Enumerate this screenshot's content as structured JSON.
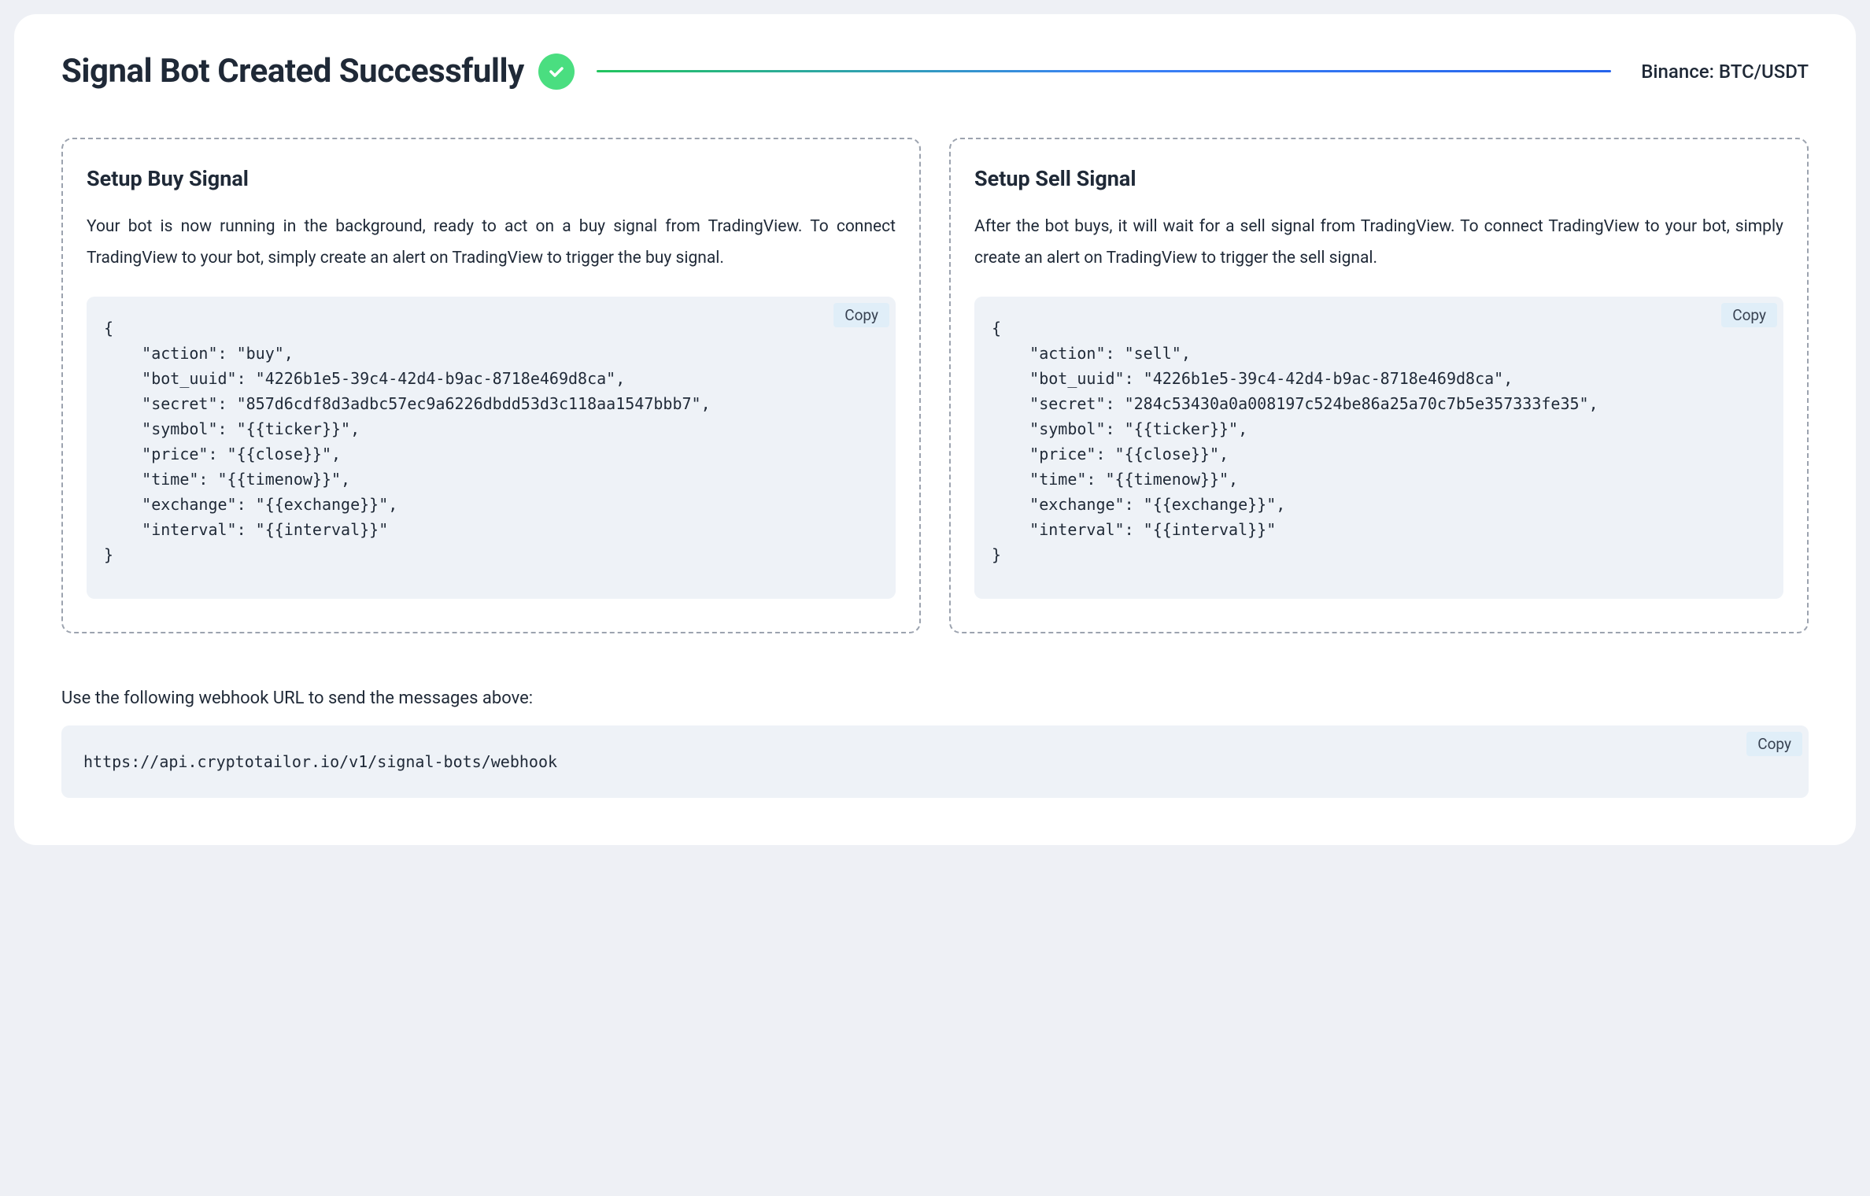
{
  "header": {
    "title": "Signal Bot Created Successfully",
    "exchange_pair": "Binance: BTC/USDT"
  },
  "buy_panel": {
    "title": "Setup Buy Signal",
    "description": "Your bot is now running in the background, ready to act on a buy signal from TradingView. To connect TradingView to your bot, simply create an alert on TradingView to trigger the buy signal.",
    "copy_label": "Copy",
    "payload": "{\n    \"action\": \"buy\",\n    \"bot_uuid\": \"4226b1e5-39c4-42d4-b9ac-8718e469d8ca\",\n    \"secret\": \"857d6cdf8d3adbc57ec9a6226dbdd53d3c118aa1547bbb7\",\n    \"symbol\": \"{{ticker}}\",\n    \"price\": \"{{close}}\",\n    \"time\": \"{{timenow}}\",\n    \"exchange\": \"{{exchange}}\",\n    \"interval\": \"{{interval}}\"\n}"
  },
  "sell_panel": {
    "title": "Setup Sell Signal",
    "description": "After the bot buys, it will wait for a sell signal from TradingView. To connect TradingView to your bot, simply create an alert on TradingView to trigger the sell signal.",
    "copy_label": "Copy",
    "payload": "{\n    \"action\": \"sell\",\n    \"bot_uuid\": \"4226b1e5-39c4-42d4-b9ac-8718e469d8ca\",\n    \"secret\": \"284c53430a0a008197c524be86a25a70c7b5e357333fe35\",\n    \"symbol\": \"{{ticker}}\",\n    \"price\": \"{{close}}\",\n    \"time\": \"{{timenow}}\",\n    \"exchange\": \"{{exchange}}\",\n    \"interval\": \"{{interval}}\"\n}"
  },
  "webhook": {
    "instruction": "Use the following webhook URL to send the messages above:",
    "copy_label": "Copy",
    "url": "https://api.cryptotailor.io/v1/signal-bots/webhook"
  }
}
